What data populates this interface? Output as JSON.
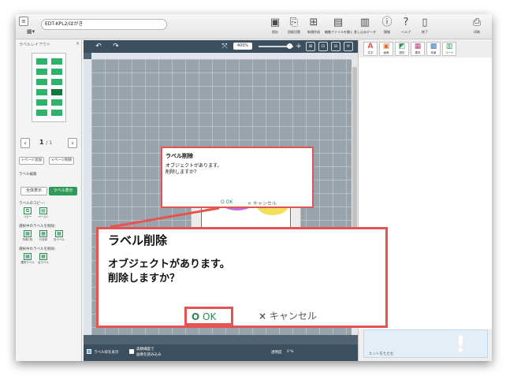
{
  "app": {
    "file_name": "EDT-KPL2/はがき",
    "menu_icon": "hamburger-menu-icon",
    "grid_icon": "grid-icon"
  },
  "toolbar": {
    "items": [
      {
        "label": "保存",
        "icon": "save-icon"
      },
      {
        "label": "用紙切替",
        "icon": "paper-switch-icon"
      },
      {
        "label": "新規作成",
        "icon": "new-document-icon"
      },
      {
        "label": "編集ファイルを開く",
        "icon": "open-file-icon"
      },
      {
        "label": "差し込みデータ",
        "icon": "merge-data-icon"
      },
      {
        "label": "情報",
        "icon": "info-icon"
      },
      {
        "label": "ヘルプ",
        "icon": "help-icon"
      },
      {
        "label": "終了",
        "icon": "exit-icon"
      },
      {
        "label": "印刷",
        "icon": "print-icon"
      }
    ]
  },
  "left_panel": {
    "title": "ラベルレイアウト",
    "close": "×",
    "page_current": "1",
    "page_total": "/ 1",
    "add_page": "+ページ追加",
    "delete_page": "×ページ削除",
    "label_edit": "ラベル編集",
    "show_all": "全体表示",
    "show_label": "ラベル表示",
    "copy_heading": "ラベルのコピー：",
    "copy": "コピー",
    "paste": "ペースト",
    "delete_heading": "選択中のラベルを削除：",
    "clear_heading": "選択中のラベルを削除：",
    "delete_buttons": [
      "対象1枚",
      "行全体",
      "全ラベル"
    ],
    "clear_buttons": [
      "選択ラベル",
      "全ラベル"
    ]
  },
  "canvas": {
    "zoom": "400%",
    "zoom_min_label": "25%",
    "show_frame": "ラベル枠を表示",
    "hq_render": "高精細度で",
    "hq_render2": "画像を読み込み",
    "transparency_label": "透明度",
    "transparency_value": "0 %"
  },
  "right_panel": {
    "tabs": [
      {
        "label": "文字",
        "icon": "A",
        "color": "#e05a4e"
      },
      {
        "label": "画像",
        "icon": "▣",
        "color": "#e07030"
      },
      {
        "label": "図形",
        "icon": "◩",
        "color": "#2f9a5a"
      },
      {
        "label": "素材",
        "icon": "▦",
        "color": "#c0407a"
      },
      {
        "label": "背景",
        "icon": "▩",
        "color": "#3a7ac0"
      },
      {
        "label": "コード",
        "icon": "▥",
        "color": "#2f9a5a"
      }
    ],
    "hint_toggle": "ヒントをたたむ",
    "hint_mark": "!"
  },
  "small_dialog": {
    "title": "ラベル削除",
    "message_line1": "オブジェクトがあります。",
    "message_line2": "削除しますか？",
    "ok": "O OK",
    "cancel": "× キャンセル"
  },
  "big_dialog": {
    "title": "ラベル削除",
    "message_line1": "オブジェクトがあります。",
    "message_line2": "削除しますか？",
    "ok": "OK",
    "cancel": "キャンセル"
  },
  "colors": {
    "highlight": "#e55450",
    "accent_green": "#2b8a56",
    "canvas_bg": "#4f6373"
  }
}
